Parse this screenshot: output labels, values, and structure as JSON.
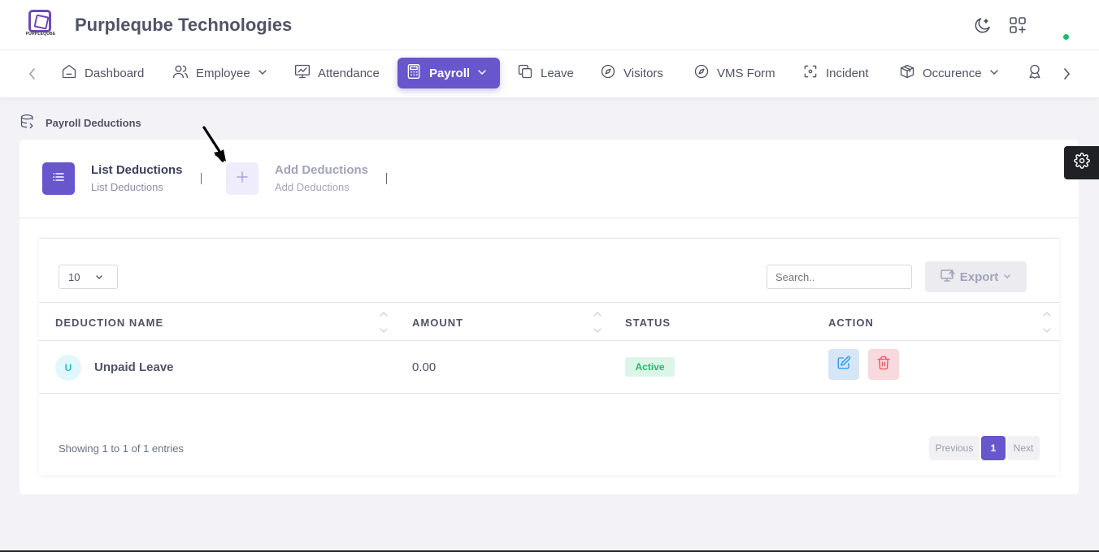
{
  "app": {
    "logo_text": "PURPLEQUBE",
    "company_name": "Purpleqube Technologies"
  },
  "header_icons": [
    "moon-icon",
    "apps-add-icon"
  ],
  "nav": {
    "items": [
      {
        "label": "Dashboard",
        "icon": "home-icon",
        "dropdown": false,
        "active": false
      },
      {
        "label": "Employee",
        "icon": "users-icon",
        "dropdown": true,
        "active": false
      },
      {
        "label": "Attendance",
        "icon": "chart-board-icon",
        "dropdown": false,
        "active": false
      },
      {
        "label": "Payroll",
        "icon": "calculator-icon",
        "dropdown": true,
        "active": true
      },
      {
        "label": "Leave",
        "icon": "copy-icon",
        "dropdown": false,
        "active": false
      },
      {
        "label": "Visitors",
        "icon": "compass-icon",
        "dropdown": false,
        "active": false
      },
      {
        "label": "VMS Form",
        "icon": "compass-icon",
        "dropdown": false,
        "active": false
      },
      {
        "label": "Incident",
        "icon": "focus-icon",
        "dropdown": false,
        "active": false
      },
      {
        "label": "Occurence",
        "icon": "box-icon",
        "dropdown": true,
        "active": false
      }
    ]
  },
  "breadcrumb": "Payroll Deductions",
  "steps": [
    {
      "title": "List Deductions",
      "subtitle": "List Deductions",
      "active": true
    },
    {
      "title": "Add Deductions",
      "subtitle": "Add Deductions",
      "active": false
    }
  ],
  "table_controls": {
    "page_length": "10",
    "search_placeholder": "Search..",
    "export_label": "Export"
  },
  "table": {
    "columns": [
      "DEDUCTION NAME",
      "AMOUNT",
      "STATUS",
      "ACTION"
    ],
    "rows": [
      {
        "avatar": "U",
        "name": "Unpaid Leave",
        "amount": "0.00",
        "status": "Active"
      }
    ]
  },
  "footer": {
    "info": "Showing 1 to 1 of 1 entries",
    "prev_label": "Previous",
    "current_page": "1",
    "next_label": "Next"
  },
  "colors": {
    "accent": "#6756cc",
    "success": "#1abc6d",
    "danger": "#e7515a",
    "info": "#2196f3"
  }
}
